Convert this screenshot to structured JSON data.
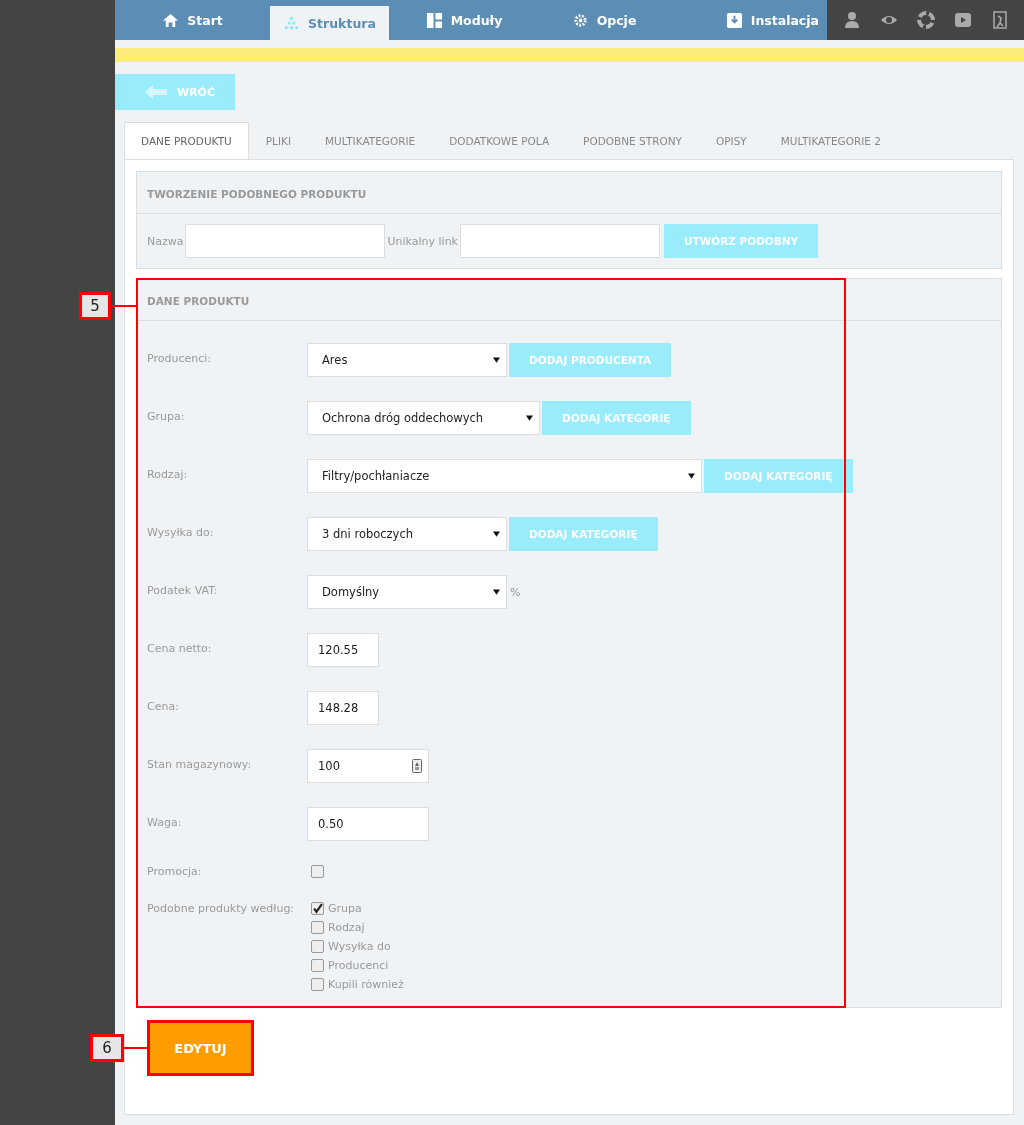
{
  "nav": {
    "tabs": [
      {
        "label": "Start",
        "selected": false
      },
      {
        "label": "Struktura",
        "selected": true
      },
      {
        "label": "Moduły",
        "selected": false
      },
      {
        "label": "Opcje",
        "selected": false
      },
      {
        "label": "Instalacja",
        "selected": false
      }
    ]
  },
  "back_button": "WRÓĆ",
  "tabs": [
    {
      "label": "DANE PRODUKTU",
      "selected": true
    },
    {
      "label": "PLIKI",
      "selected": false
    },
    {
      "label": "MULTIKATEGORIE",
      "selected": false
    },
    {
      "label": "DODATKOWE POLA",
      "selected": false
    },
    {
      "label": "PODOBNE STRONY",
      "selected": false
    },
    {
      "label": "OPISY",
      "selected": false
    },
    {
      "label": "MULTIKATEGORIE 2",
      "selected": false
    }
  ],
  "similar": {
    "title": "TWORZENIE PODOBNEGO PRODUKTU",
    "name_label": "Nazwa",
    "link_label": "Unikalny link",
    "button": "UTWÓRZ PODOBNY"
  },
  "product": {
    "title": "DANE PRODUKTU",
    "fields": [
      {
        "kind": "select",
        "label": "Producenci:",
        "value": "Ares",
        "button": "DODAJ PRODUCENTA"
      },
      {
        "kind": "select",
        "label": "Grupa:",
        "value": "Ochrona dróg oddechowych",
        "button": "DODAJ KATEGORIĘ"
      },
      {
        "kind": "select",
        "label": "Rodzaj:",
        "value": "Filtry/pochłaniacze",
        "button": "DODAJ KATEGORIĘ"
      },
      {
        "kind": "select",
        "label": "Wysyłka do:",
        "value": "3 dni roboczych",
        "button": "DODAJ KATEGORIĘ"
      },
      {
        "kind": "select",
        "label": "Podatek VAT:",
        "value": "Domyślny",
        "suffix": "%"
      },
      {
        "kind": "text",
        "label": "Cena netto:",
        "value": "120.55"
      },
      {
        "kind": "text",
        "label": "Cena:",
        "value": "148.28"
      },
      {
        "kind": "number",
        "label": "Stan magazynowy:",
        "value": "100"
      },
      {
        "kind": "text",
        "label": "Waga:",
        "value": "0.50"
      },
      {
        "kind": "checkbox",
        "label": "Promocja:",
        "checked": false
      },
      {
        "kind": "checklist",
        "label": "Podobne produkty według:",
        "options": [
          {
            "label": "Grupa",
            "checked": true
          },
          {
            "label": "Rodzaj",
            "checked": false
          },
          {
            "label": "Wysyłka do",
            "checked": false
          },
          {
            "label": "Producenci",
            "checked": false
          },
          {
            "label": "Kupili również",
            "checked": false
          }
        ]
      }
    ]
  },
  "submit": "EDYTUJ",
  "callouts": [
    {
      "label": "5"
    },
    {
      "label": "6"
    }
  ]
}
